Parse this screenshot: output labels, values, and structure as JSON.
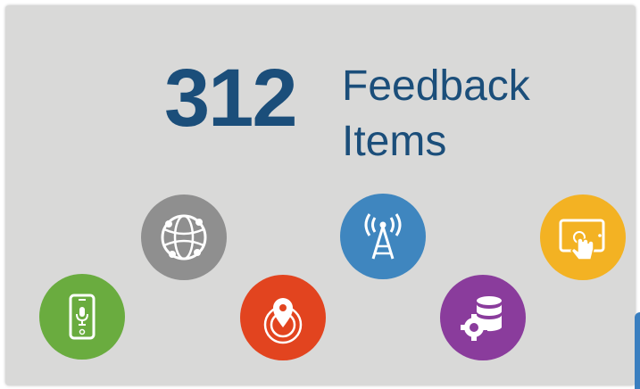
{
  "headline": {
    "count": "312",
    "label_line1": "Feedback",
    "label_line2": "Items"
  },
  "colors": {
    "background": "#d9d9d8",
    "text": "#1b4e7a"
  },
  "badges": [
    {
      "icon": "smartphone-microphone-icon",
      "color": "#6aac3f"
    },
    {
      "icon": "globe-network-icon",
      "color": "#8f8f8f"
    },
    {
      "icon": "location-pin-radar-icon",
      "color": "#e2441f"
    },
    {
      "icon": "broadcast-tower-icon",
      "color": "#3f86bf"
    },
    {
      "icon": "database-gear-icon",
      "color": "#8a3c9c"
    },
    {
      "icon": "tablet-touch-icon",
      "color": "#f3b223"
    }
  ]
}
